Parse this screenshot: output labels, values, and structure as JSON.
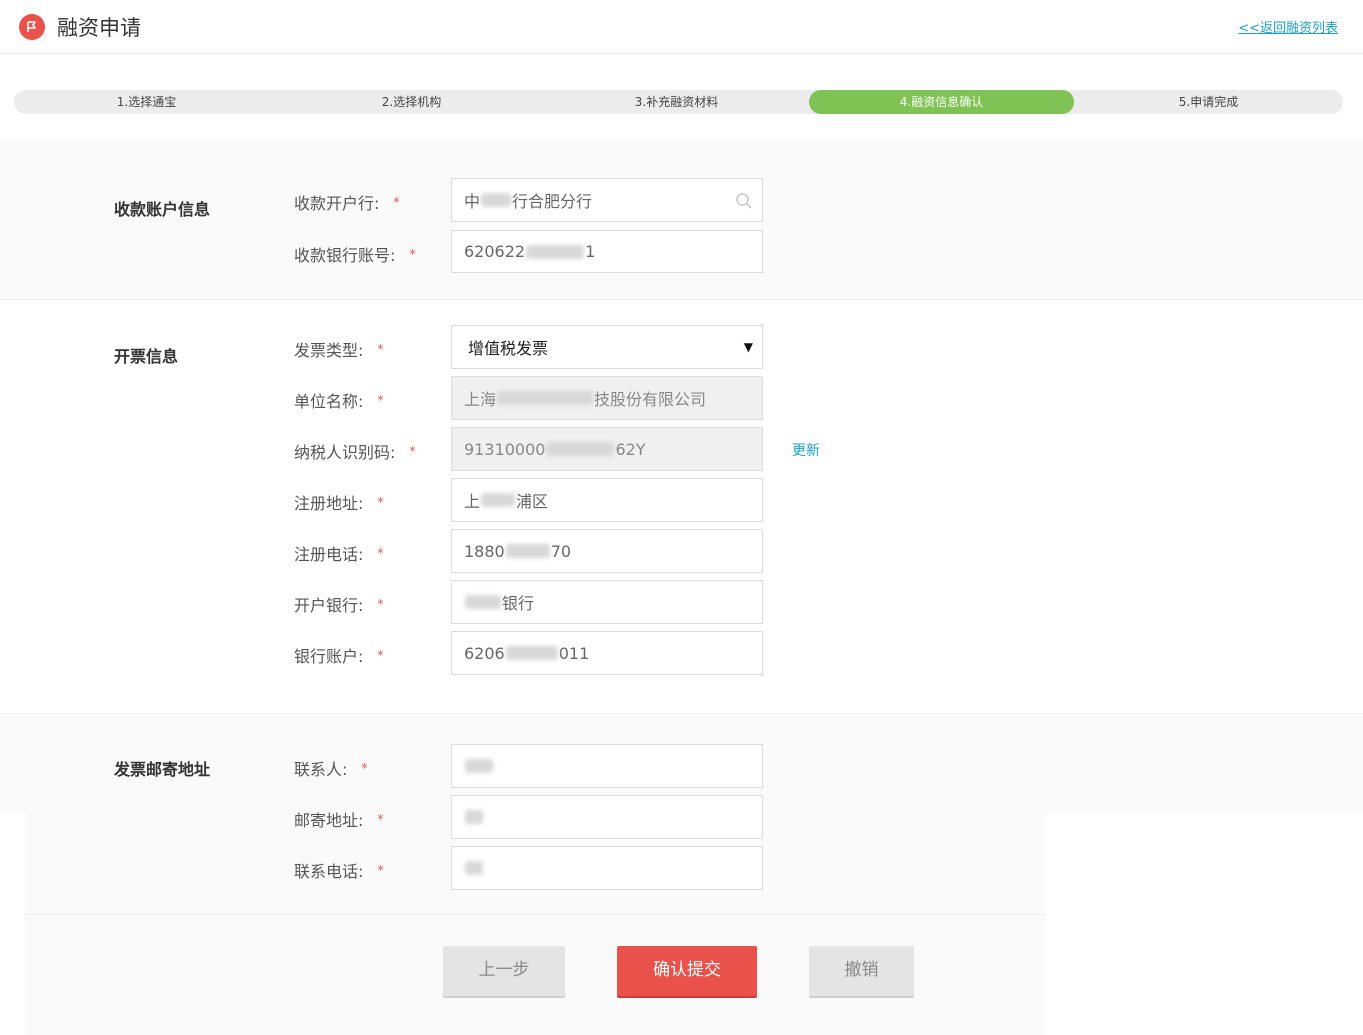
{
  "header": {
    "title": "融资申请",
    "back_link": "<<返回融资列表"
  },
  "steps": [
    {
      "label": "1.选择通宝",
      "active": false
    },
    {
      "label": "2.选择机构",
      "active": false
    },
    {
      "label": "3.补充融资材料",
      "active": false
    },
    {
      "label": "4.融资信息确认",
      "active": true
    },
    {
      "label": "5.申请完成",
      "active": false
    }
  ],
  "receiving_account": {
    "section_title": "收款账户信息",
    "bank_label": "收款开户行:",
    "bank_value_prefix": "中",
    "bank_value_suffix": "行合肥分行",
    "account_label": "收款银行账号:",
    "account_value_prefix": "620622",
    "account_value_suffix": "1"
  },
  "invoice_info": {
    "section_title": "开票信息",
    "type_label": "发票类型:",
    "type_value": "增值税发票",
    "company_label": "单位名称:",
    "company_prefix": "上海",
    "company_suffix": "技股份有限公司",
    "tax_label": "纳税人识别码:",
    "tax_prefix": "91310000",
    "tax_suffix": "62Y",
    "update_link": "更新",
    "address_label": "注册地址:",
    "address_prefix": "上",
    "address_suffix": "浦区",
    "phone_label": "注册电话:",
    "phone_prefix": "1880",
    "phone_suffix": "70",
    "bank_label": "开户银行:",
    "bank_suffix": "银行",
    "account_label": "银行账户:",
    "account_prefix": "6206",
    "account_suffix": "011"
  },
  "mailing": {
    "section_title": "发票邮寄地址",
    "contact_label": "联系人:",
    "address_label": "邮寄地址:",
    "phone_label": "联系电话:"
  },
  "required_mark": "*",
  "buttons": {
    "prev": "上一步",
    "submit": "确认提交",
    "cancel": "撤销"
  },
  "colors": {
    "accent_red": "#e8524a",
    "step_active_green": "#7ec353",
    "link_blue": "#1aa3c9"
  }
}
